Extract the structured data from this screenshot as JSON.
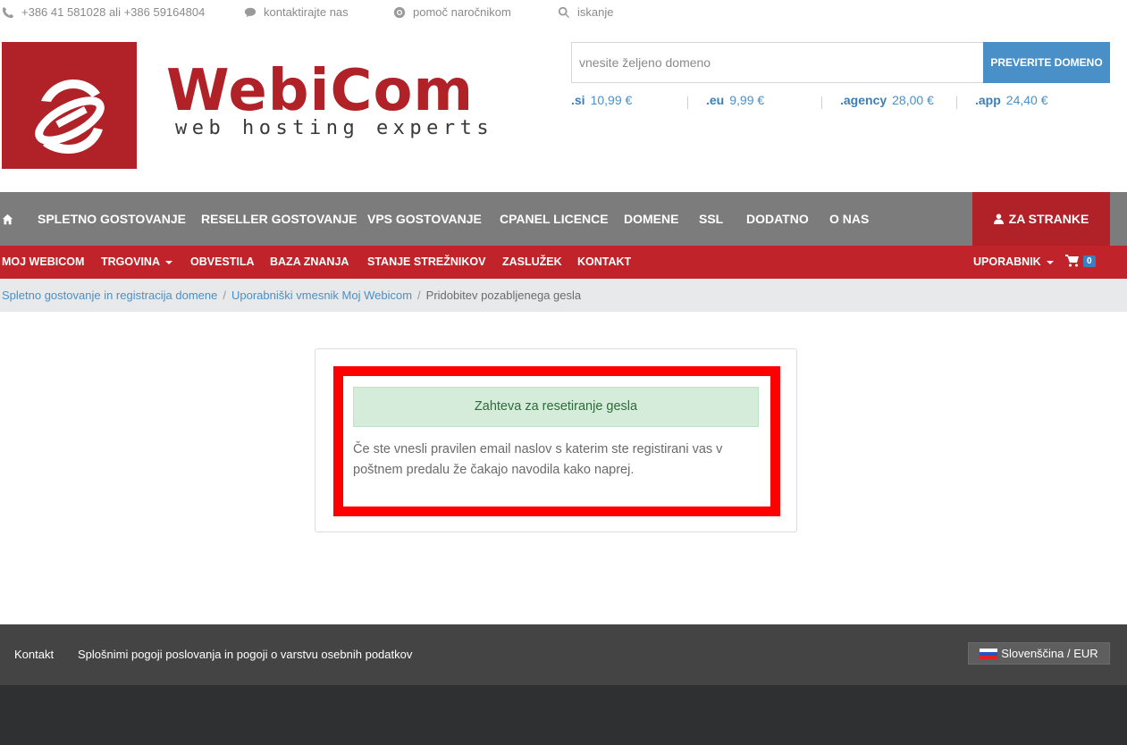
{
  "topbar": {
    "phone": "+386 41 581028 ali +386 59164804",
    "contact": "kontaktirajte nas",
    "support": "pomoč naročnikom",
    "search": "iskanje"
  },
  "logo": {
    "name": "WebiCom",
    "tagline": "web hosting experts",
    "brand_color": "#b02128"
  },
  "domain_search": {
    "placeholder": "vnesite željeno domeno",
    "value": "",
    "button_label": "PREVERITE DOMENO",
    "prices": [
      {
        "tld": ".si",
        "price": "10,99 €"
      },
      {
        "tld": ".eu",
        "price": "9,99 €"
      },
      {
        "tld": ".agency",
        "price": "28,00 €"
      },
      {
        "tld": ".app",
        "price": "24,40 €"
      }
    ]
  },
  "main_nav": {
    "items": [
      "SPLETNO GOSTOVANJE",
      "RESELLER GOSTOVANJE",
      "VPS GOSTOVANJE",
      "CPANEL LICENCE",
      "DOMENE",
      "SSL",
      "DODATNO",
      "O NAS"
    ],
    "client_button": "ZA STRANKE"
  },
  "sub_nav": {
    "items": [
      "MOJ WEBICOM",
      "TRGOVINA",
      "OBVESTILA",
      "BAZA ZNANJA",
      "STANJE STREŽNIKOV",
      "ZASLUŽEK",
      "KONTAKT"
    ],
    "user": "UPORABNIK",
    "cart_count": "0"
  },
  "breadcrumb": [
    "Spletno gostovanje in registracija domene",
    "Uporabniški vmesnik Moj Webicom",
    "Pridobitev pozabljenega gesla"
  ],
  "reset": {
    "alert": "Zahteva za resetiranje gesla",
    "message": "Če ste vnesli pravilen email naslov s katerim ste registirani vas v poštnem predalu že čakajo navodila kako naprej."
  },
  "footer": {
    "links": [
      "Kontakt",
      "Splošnimi pogoji poslovanja in pogoji o varstvu osebnih podatkov"
    ],
    "language": "Slovenščina / EUR"
  }
}
